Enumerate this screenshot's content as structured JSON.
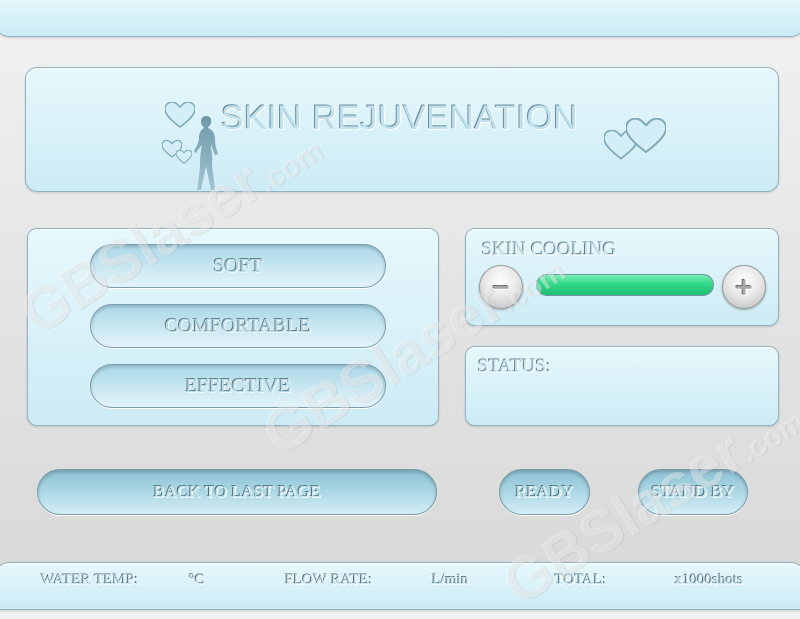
{
  "banner": {
    "title": "SKIN REJUVENATION"
  },
  "modes": [
    {
      "label": "SOFT"
    },
    {
      "label": "COMFORTABLE"
    },
    {
      "label": "EFFECTIVE"
    }
  ],
  "cooling": {
    "label": "SKIN COOLING",
    "minus_label": "−",
    "plus_label": "+",
    "level": 1.0,
    "fill_color": "#2fd987"
  },
  "status": {
    "label": "STATUS:"
  },
  "actions": {
    "back_label": "BACK TO LAST PAGE",
    "ready_label": "READY",
    "standby_label": "STAND BY"
  },
  "footer": {
    "water_temp_label": "WATER TEMP:",
    "water_temp_unit": "°C",
    "flow_rate_label": "FLOW RATE:",
    "flow_rate_unit": "L/min",
    "total_label": "TOTAL:",
    "total_unit": "x1000shots"
  },
  "watermark": {
    "text": "GBSlaser",
    "suffix": ".com"
  },
  "colors": {
    "panel_light": "#e6f8fc",
    "panel_dark": "#cdebf5",
    "accent_green": "#2fd987"
  }
}
